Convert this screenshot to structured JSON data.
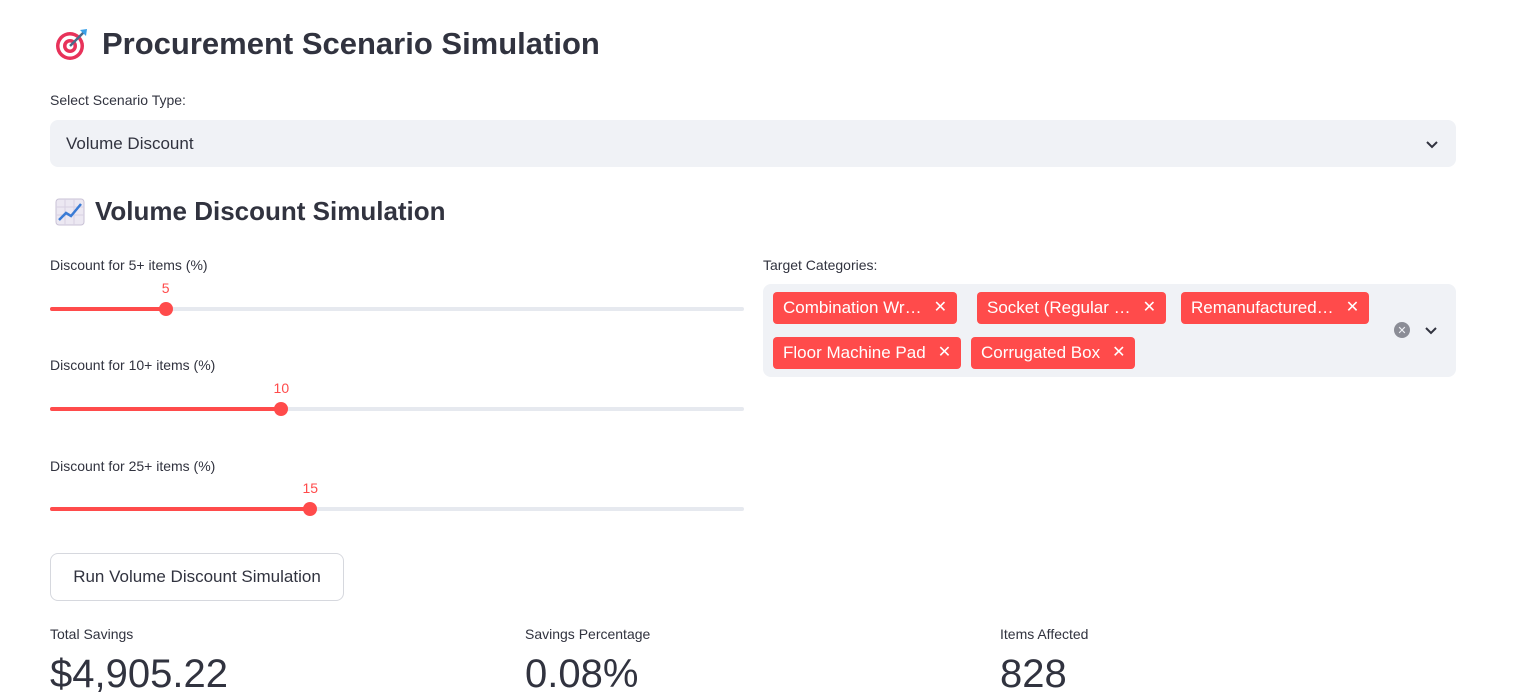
{
  "header": {
    "title": "Procurement Scenario Simulation",
    "icon": "target-icon"
  },
  "scenario_select": {
    "label": "Select Scenario Type:",
    "value": "Volume Discount"
  },
  "section": {
    "title": "Volume Discount Simulation",
    "icon": "chart-increasing-icon"
  },
  "sliders": [
    {
      "label": "Discount for 5+ items (%)",
      "value": 5,
      "display": "5",
      "min": 0,
      "max": 30
    },
    {
      "label": "Discount for 10+ items (%)",
      "value": 10,
      "display": "10",
      "min": 0,
      "max": 30
    },
    {
      "label": "Discount for 25+ items (%)",
      "value": 15,
      "display": "15",
      "min": 0,
      "max": 40
    }
  ],
  "categories": {
    "label": "Target Categories:",
    "tags": [
      "Combination Wr…",
      "Socket (Regular …",
      "Remanufactured…",
      "Floor Machine Pad",
      "Corrugated Box"
    ]
  },
  "run_button": {
    "label": "Run Volume Discount Simulation"
  },
  "metrics": [
    {
      "label": "Total Savings",
      "value": "$4,905.22"
    },
    {
      "label": "Savings Percentage",
      "value": "0.08%"
    },
    {
      "label": "Items Affected",
      "value": "828"
    }
  ],
  "colors": {
    "accent": "#ff4b4b",
    "text": "#31333f",
    "input_bg": "#f0f2f6",
    "track": "#e6e9ef"
  }
}
